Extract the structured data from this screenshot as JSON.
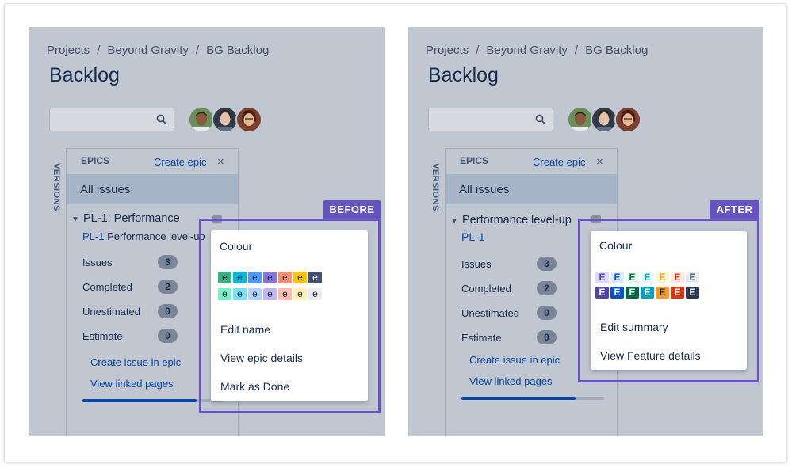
{
  "common": {
    "breadcrumb": [
      "Projects",
      "Beyond Gravity",
      "BG Backlog"
    ],
    "breadcrumb_sep": "/",
    "page_title": "Backlog",
    "epics_heading": "EPICS",
    "create_epic": "Create epic",
    "close_glyph": "×",
    "versions_label": "VERSIONS",
    "all_issues": "All issues",
    "stats": [
      {
        "label": "Issues",
        "count": "3"
      },
      {
        "label": "Completed",
        "count": "2"
      },
      {
        "label": "Unestimated",
        "count": "0"
      },
      {
        "label": "Estimate",
        "count": "0"
      }
    ],
    "actions": [
      "Create issue in epic",
      "View linked pages"
    ],
    "progress": 0.8,
    "icons": [
      "search-icon",
      "close-icon",
      "chevron-down-icon"
    ]
  },
  "before": {
    "tag": "BEFORE",
    "epic_name": "PL-1: Performance",
    "epic_key": "PL-1",
    "epic_summary": "Performance level-up",
    "menu": {
      "heading": "Colour",
      "swatch_letter": "e",
      "swatch_rows": [
        [
          "#36b37e",
          "#00b8d9",
          "#4c9aff",
          "#8777d9",
          "#ff8f73",
          "#ffc400",
          "#42526e"
        ],
        [
          "#79f2c0",
          "#79e2f2",
          "#b3d4ff",
          "#c0b6f2",
          "#ffbdad",
          "#fff0b3",
          "#ebecf0"
        ]
      ],
      "items": [
        "Edit name",
        "View epic details",
        "Mark as Done"
      ]
    }
  },
  "after": {
    "tag": "AFTER",
    "epic_name": "Performance level-up",
    "epic_key": "PL-1",
    "menu": {
      "heading": "Colour",
      "swatch_letter": "E",
      "swatch_rows": [
        [
          "#dfd8fd",
          "#deebff",
          "#e3fcef",
          "#e6fcff",
          "#fff7d6",
          "#ffebe6",
          "#ebecf0"
        ],
        [
          "#5243aa",
          "#0052cc",
          "#006644",
          "#00a3bf",
          "#ff991f",
          "#de350b",
          "#253858"
        ]
      ],
      "items": [
        "Edit summary",
        "View Feature details"
      ]
    }
  },
  "colors": {
    "accent": "#6554c0",
    "link": "#0747a6",
    "panel_bg": "#c1c7d0",
    "selected_row": "#a7b5c9"
  }
}
